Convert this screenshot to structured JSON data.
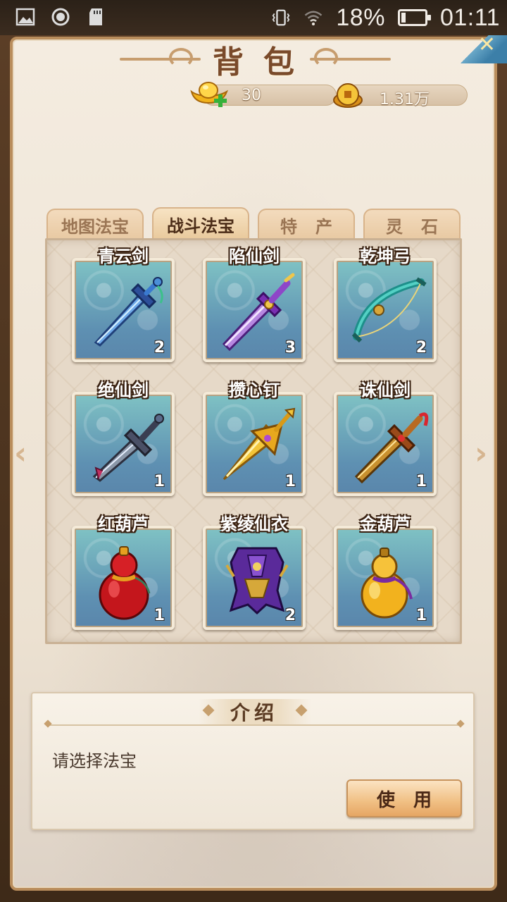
{
  "status_bar": {
    "battery_text": "18%",
    "battery_level": 0.18,
    "time": "01:11",
    "icons": [
      "image-icon",
      "record-icon",
      "sdcard-icon",
      "vibrate-icon",
      "wifi-icon",
      "battery-icon"
    ]
  },
  "header": {
    "title": "背包",
    "gold_ingot": "30",
    "coins": "1.31万"
  },
  "tabs": [
    {
      "label": "地图法宝",
      "active": false
    },
    {
      "label": "战斗法宝",
      "active": true
    },
    {
      "label": "特产",
      "active": false
    },
    {
      "label": "灵石",
      "active": false
    }
  ],
  "items": [
    {
      "name": "青云剑",
      "count": "2",
      "icon": "blue-sword-icon"
    },
    {
      "name": "陷仙剑",
      "count": "3",
      "icon": "purple-sword-icon"
    },
    {
      "name": "乾坤弓",
      "count": "2",
      "icon": "bow-icon"
    },
    {
      "name": "绝仙剑",
      "count": "1",
      "icon": "dark-sword-icon"
    },
    {
      "name": "攒心钉",
      "count": "1",
      "icon": "gold-spike-icon"
    },
    {
      "name": "诛仙剑",
      "count": "1",
      "icon": "bronze-sword-icon"
    },
    {
      "name": "红葫芦",
      "count": "1",
      "icon": "red-gourd-icon"
    },
    {
      "name": "紫绫仙衣",
      "count": "2",
      "icon": "purple-armor-icon"
    },
    {
      "name": "金葫芦",
      "count": "1",
      "icon": "gold-gourd-icon"
    }
  ],
  "intro": {
    "title": "介绍",
    "text": "请选择法宝",
    "use_button": "使用"
  },
  "colors": {
    "accent_brown": "#7a4a2a",
    "item_bg_top": "#7fc2c4",
    "item_bg_bottom": "#5a86ab",
    "button_orange": "#f0bf83"
  }
}
